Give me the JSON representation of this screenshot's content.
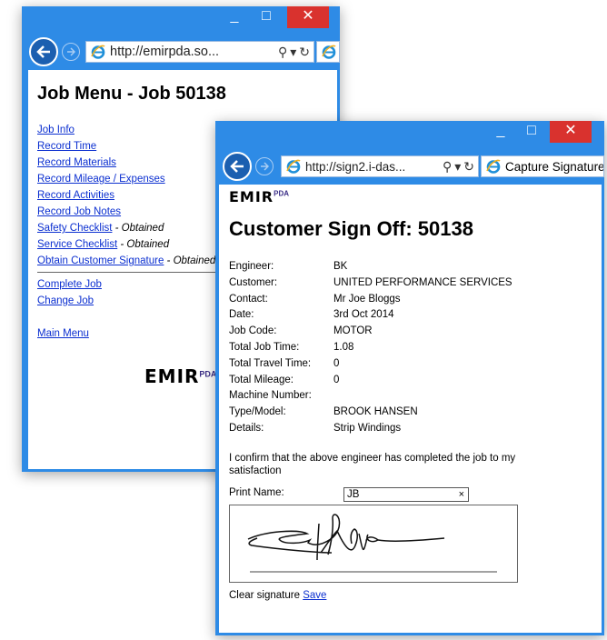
{
  "colors": {
    "window_frame": "#2e8be6",
    "close_button": "#d9322e",
    "link": "#0b2fd0",
    "logo_purple": "#3b2e86"
  },
  "titlebar": {
    "minimize_symbol": "_",
    "maximize_symbol": "□",
    "close_symbol": "✕"
  },
  "job_menu_window": {
    "address": "http://emirpda.so...",
    "search_symbol": "⚲",
    "dropdown_symbol": "▾",
    "refresh_symbol": "↻",
    "title": "Job Menu - Job 50138",
    "menu_items": [
      {
        "label": "Job Info",
        "status": ""
      },
      {
        "label": "Record Time",
        "status": ""
      },
      {
        "label": "Record Materials",
        "status": ""
      },
      {
        "label": "Record Mileage / Expenses",
        "status": ""
      },
      {
        "label": "Record Activities",
        "status": ""
      },
      {
        "label": "Record Job Notes",
        "status": ""
      },
      {
        "label": "Safety Checklist",
        "status": " - Obtained"
      },
      {
        "label": "Service Checklist",
        "status": " - Obtained"
      },
      {
        "label": "Obtain Customer Signature",
        "status": " - Obtained"
      }
    ],
    "job_actions": [
      "Complete Job",
      "Change Job"
    ],
    "main_menu": "Main Menu",
    "logo_text": "EMIR",
    "logo_superscript": "PDA"
  },
  "signoff_window": {
    "address": "http://sign2.i-das...",
    "tab_label": "Capture Signature",
    "search_symbol": "⚲",
    "dropdown_symbol": "▾",
    "refresh_symbol": "↻",
    "logo_text": "EMIR",
    "logo_superscript": "PDA",
    "title": "Customer Sign Off: 50138",
    "details": [
      {
        "label": "Engineer:",
        "value": "BK"
      },
      {
        "label": "Customer:",
        "value": "UNITED PERFORMANCE SERVICES"
      },
      {
        "label": "Contact:",
        "value": "Mr Joe Bloggs"
      },
      {
        "label": "Date:",
        "value": "3rd Oct 2014"
      },
      {
        "label": "Job Code:",
        "value": "MOTOR"
      },
      {
        "label": "Total Job Time:",
        "value": "1.08"
      },
      {
        "label": "Total Travel Time:",
        "value": "0"
      },
      {
        "label": "Total Mileage:",
        "value": "0"
      },
      {
        "label": "Machine Number:",
        "value": ""
      },
      {
        "label": "Type/Model:",
        "value": "BROOK HANSEN"
      },
      {
        "label": "Details:",
        "value": "Strip Windings"
      }
    ],
    "confirmation_text": "I confirm that the above engineer has completed the job to my satisfaction",
    "print_name_label": "Print Name:",
    "print_name_value": "JB",
    "clear_symbol": "×",
    "clear_signature_label": "Clear signature",
    "save_label": "Save"
  }
}
